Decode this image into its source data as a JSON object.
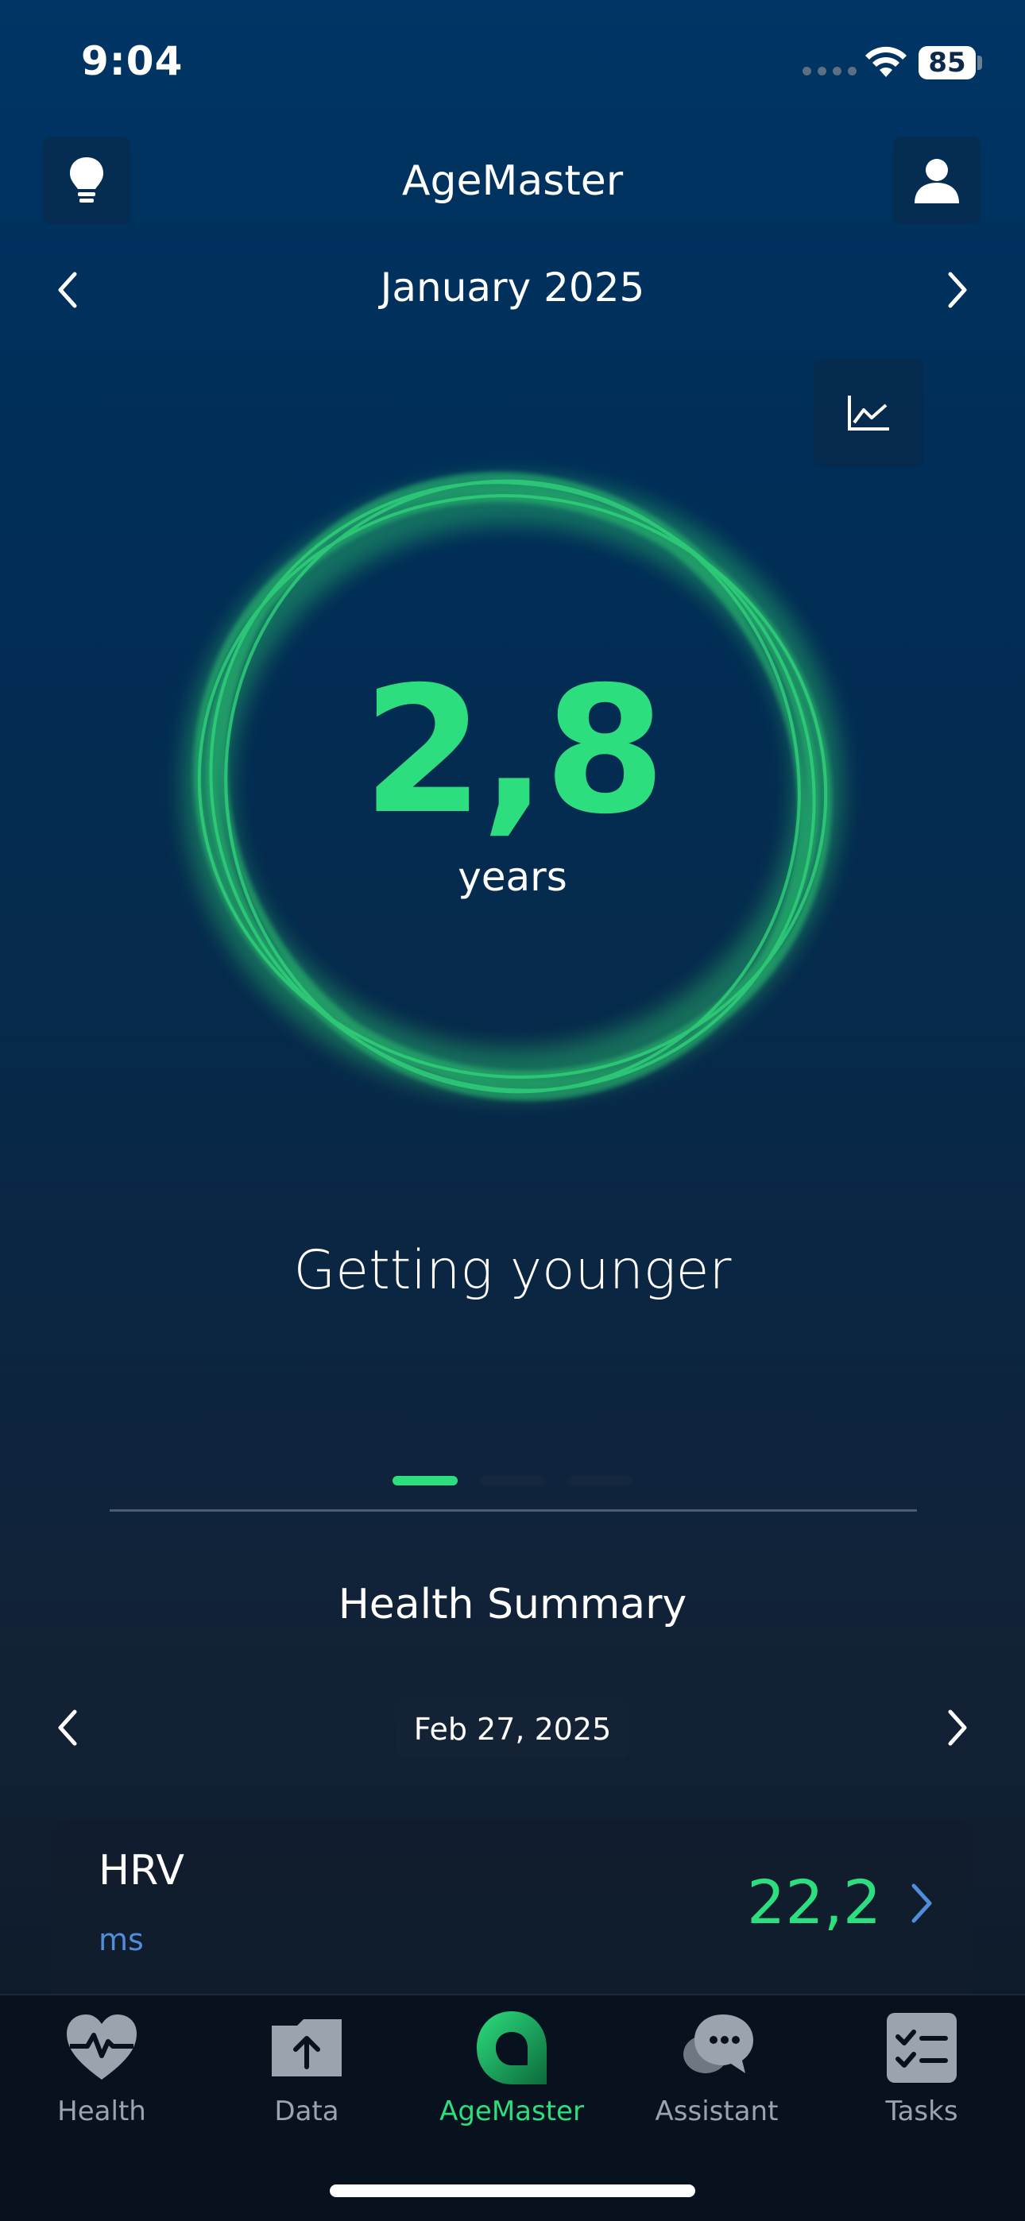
{
  "status_bar": {
    "time": "9:04",
    "battery": "85"
  },
  "header": {
    "title": "AgeMaster",
    "left_icon": "lightbulb-icon",
    "right_icon": "user-icon"
  },
  "period": {
    "label": "January 2025"
  },
  "age": {
    "value": "2,8",
    "unit": "years",
    "status": "Getting younger"
  },
  "pager": {
    "pages": 3,
    "active": 1
  },
  "summary": {
    "title": "Health Summary",
    "date": "Feb 27, 2025",
    "metric": {
      "name": "HRV",
      "unit": "ms",
      "value": "22,2"
    }
  },
  "tabs": [
    {
      "label": "Health",
      "icon": "heart-pulse-icon",
      "active": false
    },
    {
      "label": "Data",
      "icon": "upload-folder-icon",
      "active": false
    },
    {
      "label": "AgeMaster",
      "icon": "agemaster-logo-icon",
      "active": true
    },
    {
      "label": "Assistant",
      "icon": "chat-bubbles-icon",
      "active": false
    },
    {
      "label": "Tasks",
      "icon": "checklist-icon",
      "active": false
    }
  ],
  "colors": {
    "accent": "#2dde7e",
    "unit_blue": "#4f8ed8",
    "inactive": "#9aa3ae"
  }
}
